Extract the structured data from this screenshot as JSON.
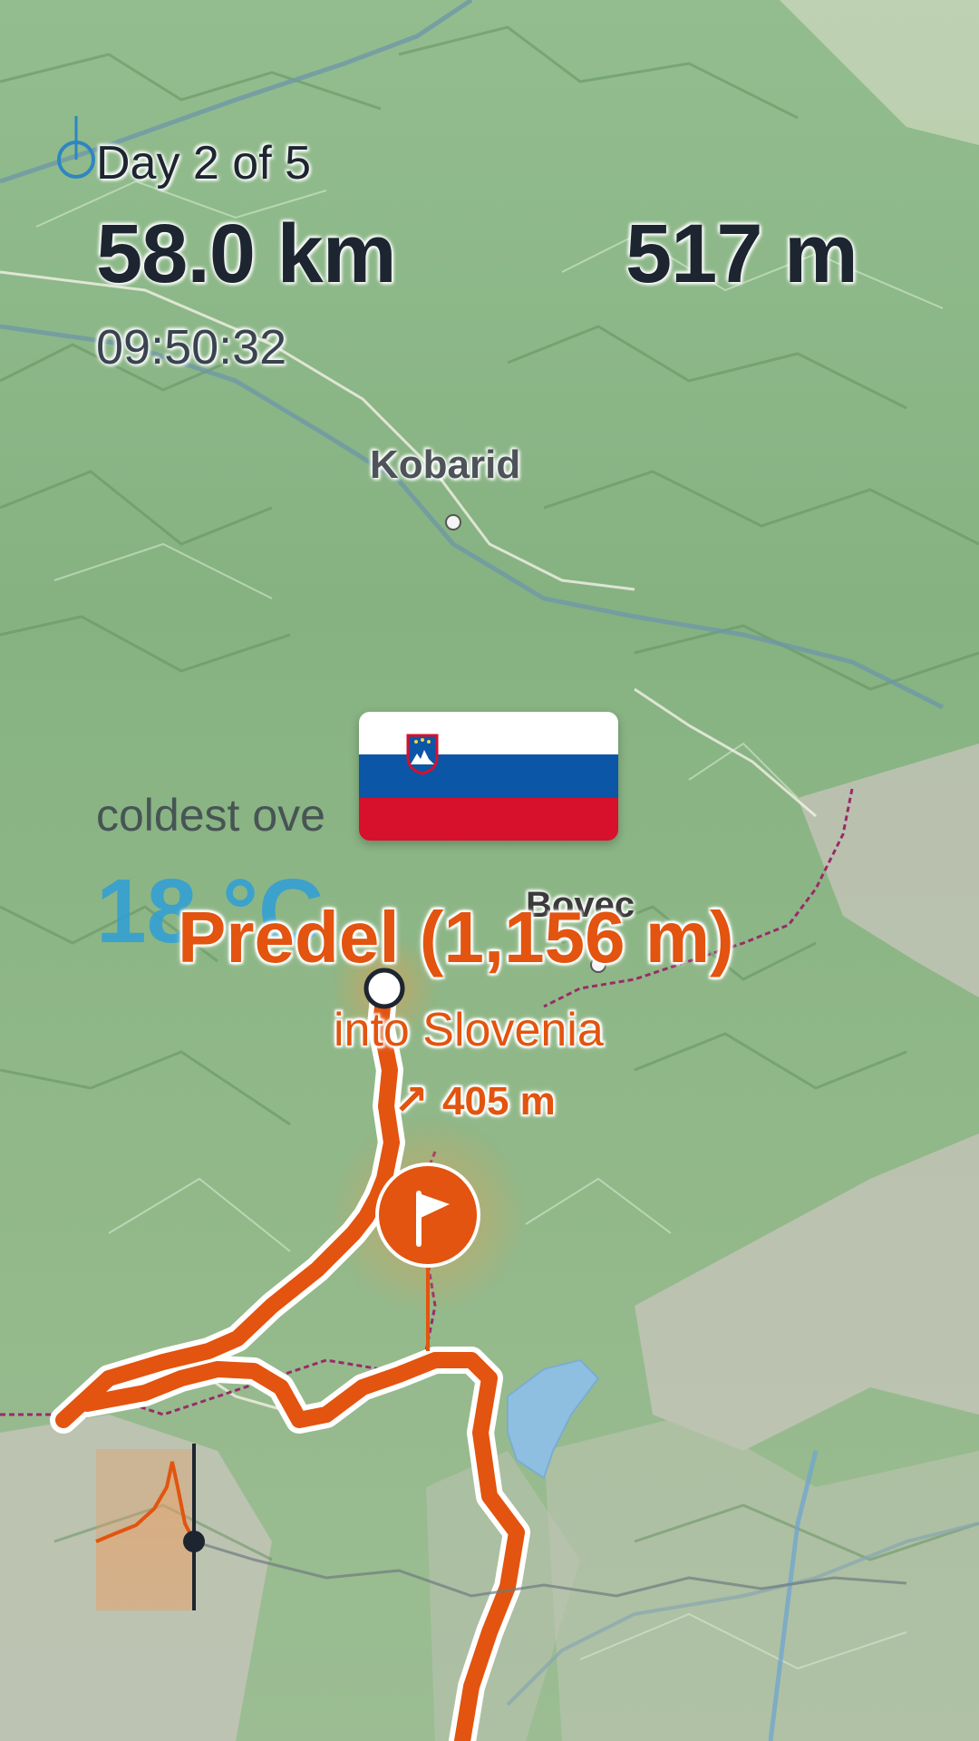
{
  "overlay": {
    "day_label": "Day 2 of 5",
    "distance": "58.0 km",
    "elevation_gain": "517 m",
    "elapsed_time": "09:50:32",
    "coldest_label": "coldest ove",
    "coldest_temp": "18 °C"
  },
  "map": {
    "towns": [
      {
        "name": "Kobarid"
      },
      {
        "name": "Bovec"
      }
    ],
    "highlight": {
      "pass_label": "Predel (1,156 m)",
      "border_label": "into Slovenia",
      "climb_label": "405 m"
    },
    "flag": {
      "country": "Slovenia",
      "colors": [
        "#ffffff",
        "#0b56a6",
        "#d7102c"
      ]
    },
    "route_color": "#e2540f"
  },
  "profile": {
    "color": "#e2540f"
  }
}
